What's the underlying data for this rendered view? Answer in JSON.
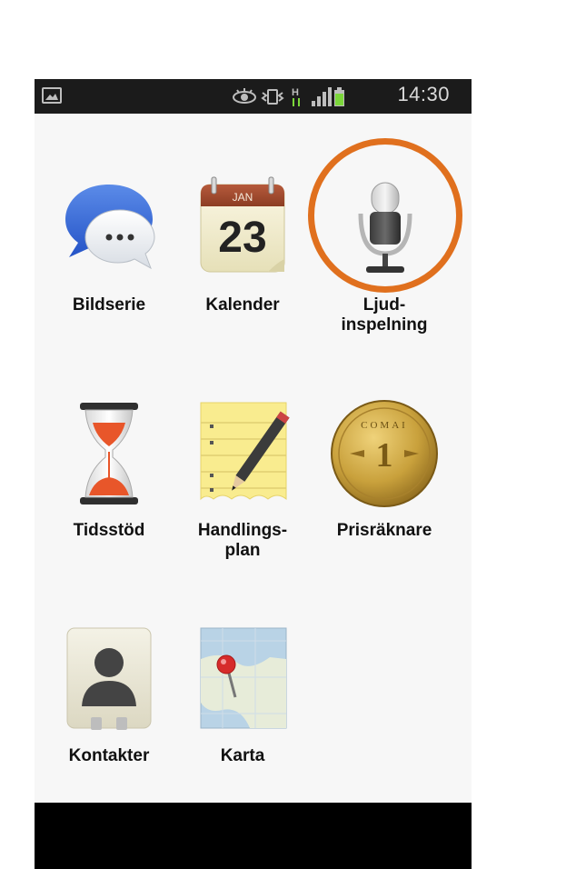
{
  "status_bar": {
    "time": "14:30",
    "icons": [
      "image-icon",
      "eye-icon",
      "vibrate-icon",
      "network-h-icon",
      "signal-icon",
      "battery-icon"
    ]
  },
  "apps": [
    {
      "label": "Bildserie",
      "icon": "chat-bubbles-icon"
    },
    {
      "label": "Kalender",
      "icon": "calendar-icon",
      "month": "JAN",
      "day": "23"
    },
    {
      "label": "Ljud-\ninspelning",
      "icon": "microphone-icon",
      "highlighted": true
    },
    {
      "label": "Tidsstöd",
      "icon": "hourglass-icon"
    },
    {
      "label": "Handlings-\nplan",
      "icon": "notepad-pencil-icon"
    },
    {
      "label": "Prisräknare",
      "icon": "coin-icon",
      "coin_text": "COMAI",
      "coin_value": "1"
    },
    {
      "label": "Kontakter",
      "icon": "contacts-icon"
    },
    {
      "label": "Karta",
      "icon": "map-pin-icon"
    }
  ],
  "colors": {
    "highlight_ring": "#e0701e",
    "status_bar": "#1b1b1b",
    "battery": "#7bd63a"
  }
}
